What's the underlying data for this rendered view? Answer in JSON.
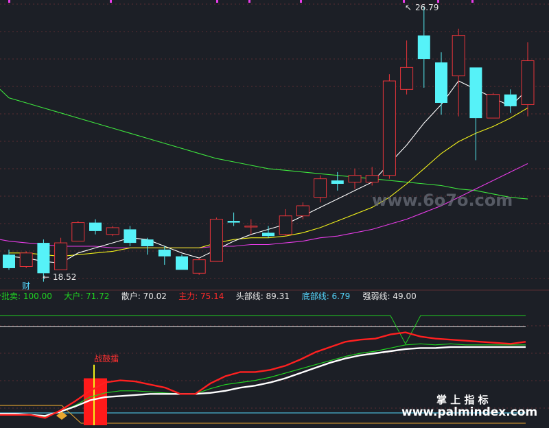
{
  "chart_data": [
    {
      "type": "candlestick",
      "annotations": {
        "high_label": "26.79",
        "low_label": "18.52",
        "cai_label": "财"
      },
      "candles": [
        {
          "o": 19.4,
          "h": 19.55,
          "l": 18.95,
          "c": 19.0
        },
        {
          "o": 19.05,
          "h": 19.5,
          "l": 19.0,
          "c": 19.45
        },
        {
          "o": 19.75,
          "h": 19.85,
          "l": 18.6,
          "c": 18.85
        },
        {
          "o": 18.95,
          "h": 19.9,
          "l": 18.95,
          "c": 19.75
        },
        {
          "o": 19.8,
          "h": 20.4,
          "l": 19.8,
          "c": 20.35
        },
        {
          "o": 20.35,
          "h": 20.45,
          "l": 20.0,
          "c": 20.1
        },
        {
          "o": 20.0,
          "h": 20.25,
          "l": 19.95,
          "c": 20.2
        },
        {
          "o": 20.15,
          "h": 20.25,
          "l": 19.65,
          "c": 19.75
        },
        {
          "o": 19.85,
          "h": 19.9,
          "l": 19.4,
          "c": 19.65
        },
        {
          "o": 19.55,
          "h": 19.65,
          "l": 19.1,
          "c": 19.35
        },
        {
          "o": 19.35,
          "h": 19.4,
          "l": 18.95,
          "c": 18.95
        },
        {
          "o": 18.85,
          "h": 19.3,
          "l": 18.8,
          "c": 19.25
        },
        {
          "o": 19.2,
          "h": 20.5,
          "l": 19.2,
          "c": 20.45
        },
        {
          "o": 20.4,
          "h": 20.65,
          "l": 20.25,
          "c": 20.35
        },
        {
          "o": 20.25,
          "h": 20.45,
          "l": 20.0,
          "c": 20.25
        },
        {
          "o": 20.05,
          "h": 20.25,
          "l": 19.9,
          "c": 19.95
        },
        {
          "o": 20.0,
          "h": 20.75,
          "l": 19.95,
          "c": 20.55
        },
        {
          "o": 20.55,
          "h": 20.95,
          "l": 20.45,
          "c": 20.85
        },
        {
          "o": 21.1,
          "h": 21.75,
          "l": 20.95,
          "c": 21.65
        },
        {
          "o": 21.6,
          "h": 21.85,
          "l": 21.3,
          "c": 21.5
        },
        {
          "o": 21.55,
          "h": 21.95,
          "l": 21.35,
          "c": 21.75
        },
        {
          "o": 21.55,
          "h": 22.0,
          "l": 21.45,
          "c": 21.75
        },
        {
          "o": 21.75,
          "h": 24.75,
          "l": 21.65,
          "c": 24.55
        },
        {
          "o": 24.3,
          "h": 25.75,
          "l": 24.15,
          "c": 24.95
        },
        {
          "o": 25.9,
          "h": 26.75,
          "l": 24.35,
          "c": 25.2
        },
        {
          "o": 25.1,
          "h": 25.4,
          "l": 23.55,
          "c": 23.9
        },
        {
          "o": 24.7,
          "h": 26.1,
          "l": 23.5,
          "c": 25.9
        },
        {
          "o": 24.95,
          "h": 24.95,
          "l": 22.2,
          "c": 23.45
        },
        {
          "o": 23.45,
          "h": 24.2,
          "l": 23.45,
          "c": 24.15
        },
        {
          "o": 24.15,
          "h": 24.3,
          "l": 23.6,
          "c": 23.8
        },
        {
          "o": 23.85,
          "h": 25.7,
          "l": 23.5,
          "c": 25.15
        }
      ],
      "ma_white": [
        19.35,
        19.3,
        19.2,
        19.15,
        19.45,
        19.6,
        19.75,
        19.9,
        19.85,
        19.65,
        19.45,
        19.3,
        19.55,
        19.8,
        20.0,
        20.15,
        20.3,
        20.55,
        20.8,
        21.05,
        21.3,
        21.55,
        22.1,
        22.65,
        23.3,
        23.85,
        24.55,
        24.3,
        24.05,
        23.8,
        24.3
      ],
      "ma_yellow": [
        19.45,
        19.45,
        19.4,
        19.35,
        19.4,
        19.45,
        19.5,
        19.6,
        19.6,
        19.6,
        19.6,
        19.6,
        19.75,
        19.85,
        19.9,
        19.9,
        19.95,
        20.05,
        20.2,
        20.4,
        20.6,
        20.8,
        21.1,
        21.5,
        21.95,
        22.4,
        22.75,
        23.0,
        23.2,
        23.45,
        23.75
      ],
      "ma_magenta": [
        19.8,
        19.75,
        19.7,
        19.65,
        19.65,
        19.65,
        19.6,
        19.6,
        19.6,
        19.6,
        19.6,
        19.6,
        19.65,
        19.65,
        19.7,
        19.7,
        19.75,
        19.8,
        19.9,
        19.95,
        20.05,
        20.15,
        20.3,
        20.45,
        20.65,
        20.85,
        21.1,
        21.35,
        21.6,
        21.85,
        22.1
      ],
      "ma_green": [
        24.05,
        23.9,
        23.75,
        23.6,
        23.45,
        23.3,
        23.15,
        23.0,
        22.85,
        22.7,
        22.55,
        22.4,
        22.25,
        22.15,
        22.05,
        21.95,
        21.9,
        21.85,
        21.8,
        21.75,
        21.7,
        21.65,
        21.6,
        21.55,
        21.5,
        21.45,
        21.35,
        21.3,
        21.2,
        21.1,
        21.05
      ],
      "y_range": [
        18.45,
        26.95
      ]
    },
    {
      "type": "line",
      "legend": [
        {
          "label": "分批卖:",
          "value": "100.00",
          "color": "#21d321"
        },
        {
          "label": "大户:",
          "value": "71.72",
          "color": "#21d321"
        },
        {
          "label": "散户:",
          "value": "70.02",
          "color": "#e8e8e8"
        },
        {
          "label": "主力:",
          "value": "75.14",
          "color": "#ff2a2a"
        },
        {
          "label": "头部线:",
          "value": "89.31",
          "color": "#e8e8e8"
        },
        {
          "label": "底部线:",
          "value": "6.79",
          "color": "#55d8ff"
        },
        {
          "label": "强弱线:",
          "value": "49.00",
          "color": "#e8e8e8"
        }
      ],
      "y_range": [
        -5,
        110
      ],
      "series_main": [
        5,
        5,
        5,
        2,
        9,
        18,
        28,
        36,
        38,
        37,
        34,
        31,
        25,
        25,
        35,
        42,
        46,
        46,
        48,
        52,
        58,
        65,
        70,
        75,
        77,
        78,
        82,
        84,
        80,
        78,
        77,
        76,
        75,
        74,
        73,
        75
      ],
      "series_big": [
        5,
        5,
        5,
        3,
        8,
        14,
        22,
        26,
        28,
        28,
        27,
        26,
        25,
        25,
        30,
        34,
        36,
        38,
        41,
        45,
        49,
        53,
        57,
        61,
        64,
        66,
        69,
        72,
        73,
        72,
        73,
        72,
        72,
        72,
        72,
        72
      ],
      "series_retail": [
        6,
        6,
        5,
        4,
        8,
        13,
        19,
        22,
        23,
        24,
        25,
        25,
        25,
        25,
        26,
        28,
        31,
        33,
        36,
        40,
        45,
        50,
        55,
        59,
        62,
        64,
        66,
        68,
        69,
        69,
        70,
        70,
        70,
        70,
        70,
        70
      ],
      "series_sell": [
        100,
        100,
        100,
        100,
        100,
        100,
        100,
        100,
        100,
        100,
        100,
        100,
        100,
        100,
        100,
        100,
        100,
        100,
        100,
        100,
        100,
        100,
        100,
        100,
        100,
        100,
        100,
        73,
        100,
        100,
        100,
        100,
        100,
        100,
        100,
        100
      ],
      "head_line": 89.31,
      "bottom_line": 6.79,
      "strong_line": 49.0,
      "signal_label": "战鼓擂"
    }
  ],
  "watermarks": {
    "top": "www.6o7o.com",
    "bottom_cn": "掌 上 指 标",
    "bottom_url": "www.palmindex.com"
  },
  "colors": {
    "up": "#e8343a",
    "down": "#56f2f8",
    "ma_white": "#ffffff",
    "ma_yellow": "#f2f21a",
    "ma_magenta": "#e83ce8",
    "ma_green": "#3ee63e",
    "grid": "#5a2c33"
  }
}
